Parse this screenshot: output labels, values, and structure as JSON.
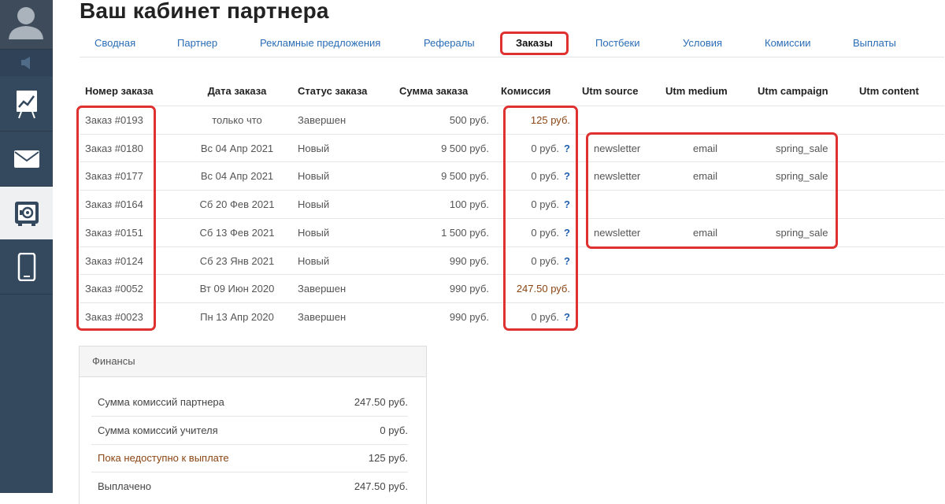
{
  "page": {
    "title": "Ваш кабинет партнера"
  },
  "tabs": [
    {
      "label": "Сводная"
    },
    {
      "label": "Партнер"
    },
    {
      "label": "Рекламные предложения"
    },
    {
      "label": "Рефералы"
    },
    {
      "label": "Заказы",
      "active": true
    },
    {
      "label": "Постбеки"
    },
    {
      "label": "Условия"
    },
    {
      "label": "Комиссии"
    },
    {
      "label": "Выплаты"
    }
  ],
  "orders": {
    "headers": {
      "number": "Номер заказа",
      "date": "Дата заказа",
      "status": "Статус заказа",
      "sum": "Сумма заказа",
      "commission": "Комиссия",
      "utm_source": "Utm source",
      "utm_medium": "Utm medium",
      "utm_campaign": "Utm campaign",
      "utm_content": "Utm content"
    },
    "rows": [
      {
        "number": "Заказ #0193",
        "date": "только что",
        "status": "Завершен",
        "sum": "500 руб.",
        "commission": "125 руб.",
        "help": "",
        "utm_source": "",
        "utm_medium": "",
        "utm_campaign": ""
      },
      {
        "number": "Заказ #0180",
        "date": "Вс 04 Апр 2021",
        "status": "Новый",
        "sum": "9 500 руб.",
        "commission": "0 руб.",
        "help": "?",
        "utm_source": "newsletter",
        "utm_medium": "email",
        "utm_campaign": "spring_sale"
      },
      {
        "number": "Заказ #0177",
        "date": "Вс 04 Апр 2021",
        "status": "Новый",
        "sum": "9 500 руб.",
        "commission": "0 руб.",
        "help": "?",
        "utm_source": "newsletter",
        "utm_medium": "email",
        "utm_campaign": "spring_sale"
      },
      {
        "number": "Заказ #0164",
        "date": "Сб 20 Фев 2021",
        "status": "Новый",
        "sum": "100 руб.",
        "commission": "0 руб.",
        "help": "?",
        "utm_source": "",
        "utm_medium": "",
        "utm_campaign": ""
      },
      {
        "number": "Заказ #0151",
        "date": "Сб 13 Фев 2021",
        "status": "Новый",
        "sum": "1 500 руб.",
        "commission": "0 руб.",
        "help": "?",
        "utm_source": "newsletter",
        "utm_medium": "email",
        "utm_campaign": "spring_sale"
      },
      {
        "number": "Заказ #0124",
        "date": "Сб 23 Янв 2021",
        "status": "Новый",
        "sum": "990 руб.",
        "commission": "0 руб.",
        "help": "?",
        "utm_source": "",
        "utm_medium": "",
        "utm_campaign": ""
      },
      {
        "number": "Заказ #0052",
        "date": "Вт 09 Июн 2020",
        "status": "Завершен",
        "sum": "990 руб.",
        "commission": "247.50 руб.",
        "help": "",
        "utm_source": "",
        "utm_medium": "",
        "utm_campaign": ""
      },
      {
        "number": "Заказ #0023",
        "date": "Пн 13 Апр 2020",
        "status": "Завершен",
        "sum": "990 руб.",
        "commission": "0 руб.",
        "help": "?",
        "utm_source": "",
        "utm_medium": "",
        "utm_campaign": ""
      }
    ]
  },
  "finance": {
    "title": "Финансы",
    "rows": [
      {
        "label": "Сумма комиссий партнера",
        "value": "247.50 руб."
      },
      {
        "label": "Сумма комиссий учителя",
        "value": "0 руб."
      },
      {
        "label": "Пока недоступно к выплате",
        "value": "125 руб."
      },
      {
        "label": "Выплачено",
        "value": "247.50 руб."
      }
    ]
  },
  "sidebar": {
    "icons": [
      "user-avatar-icon",
      "announce-icon",
      "chart-icon",
      "mail-icon",
      "safe-icon",
      "mobile-icon"
    ]
  },
  "colors": {
    "sidebar": "#34495e",
    "link": "#2a6db5",
    "highlight": "#e03131",
    "warm_text": "#8b4513"
  }
}
